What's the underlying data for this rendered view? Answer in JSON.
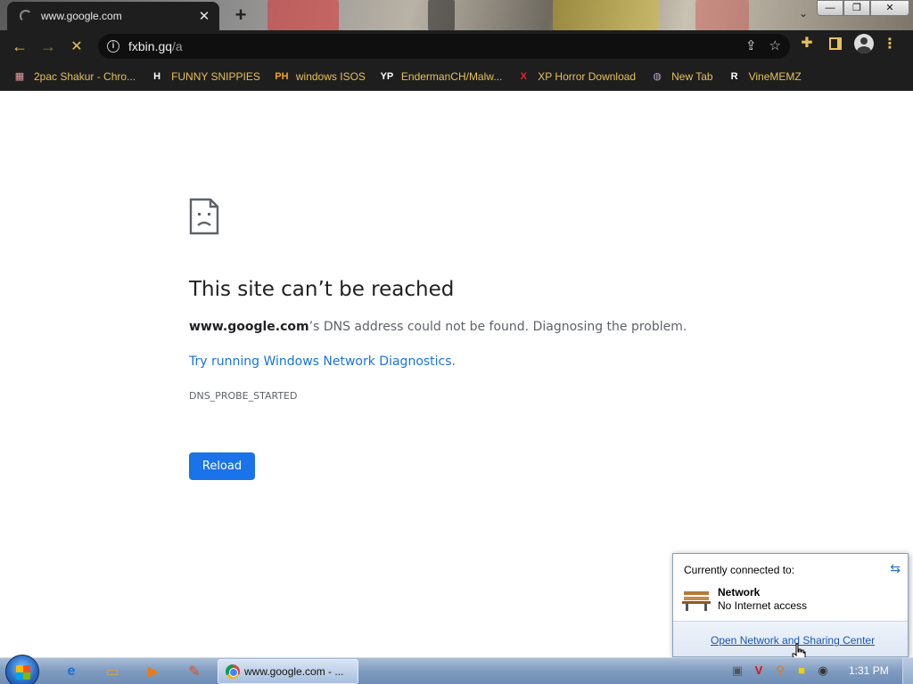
{
  "tab": {
    "title": "www.google.com",
    "close": "✕"
  },
  "window_controls": {
    "minimize": "—",
    "maximize": "❐",
    "close": "✕"
  },
  "omnibox": {
    "host": "fxbin.gq",
    "path": "/a"
  },
  "bookmarks": [
    {
      "label": "2pac Shakur - Chro...",
      "icon": "store-icon",
      "glyph": "▦",
      "color": "#e8a0a0"
    },
    {
      "label": "FUNNY SNIPPIES",
      "icon": "h-icon",
      "glyph": "H",
      "color": "#ffffff"
    },
    {
      "label": "windows ISOS",
      "icon": "ph-icon",
      "glyph": "PH",
      "color": "#f7a21b"
    },
    {
      "label": "EndermanCH/Malw...",
      "icon": "yp-icon",
      "glyph": "YP",
      "color": "#ffffff"
    },
    {
      "label": "XP Horror Download",
      "icon": "x-icon",
      "glyph": "X",
      "color": "#e0282e"
    },
    {
      "label": "New Tab",
      "icon": "globe-icon",
      "glyph": "◍",
      "color": "#b9a3c9"
    },
    {
      "label": "VineMEMZ",
      "icon": "r-icon",
      "glyph": "R",
      "color": "#ffffff"
    }
  ],
  "error": {
    "title": "This site can’t be reached",
    "host": "www.google.com",
    "desc_rest": "’s DNS address could not be found. Diagnosing the problem.",
    "diag_link": "Try running Windows Network Diagnostics",
    "diag_period": ".",
    "code": "DNS_PROBE_STARTED",
    "reload": "Reload"
  },
  "network_flyout": {
    "heading": "Currently connected to:",
    "network_name": "Network",
    "network_status": "No Internet access",
    "link": "Open Network and Sharing Center"
  },
  "taskbar": {
    "task_label": "www.google.com - ...",
    "clock": "1:31 PM"
  },
  "colors": {
    "accent": "#1a73e8",
    "toolbar_bg": "#1e1e1e",
    "bookmark_text": "#e6c15a"
  }
}
